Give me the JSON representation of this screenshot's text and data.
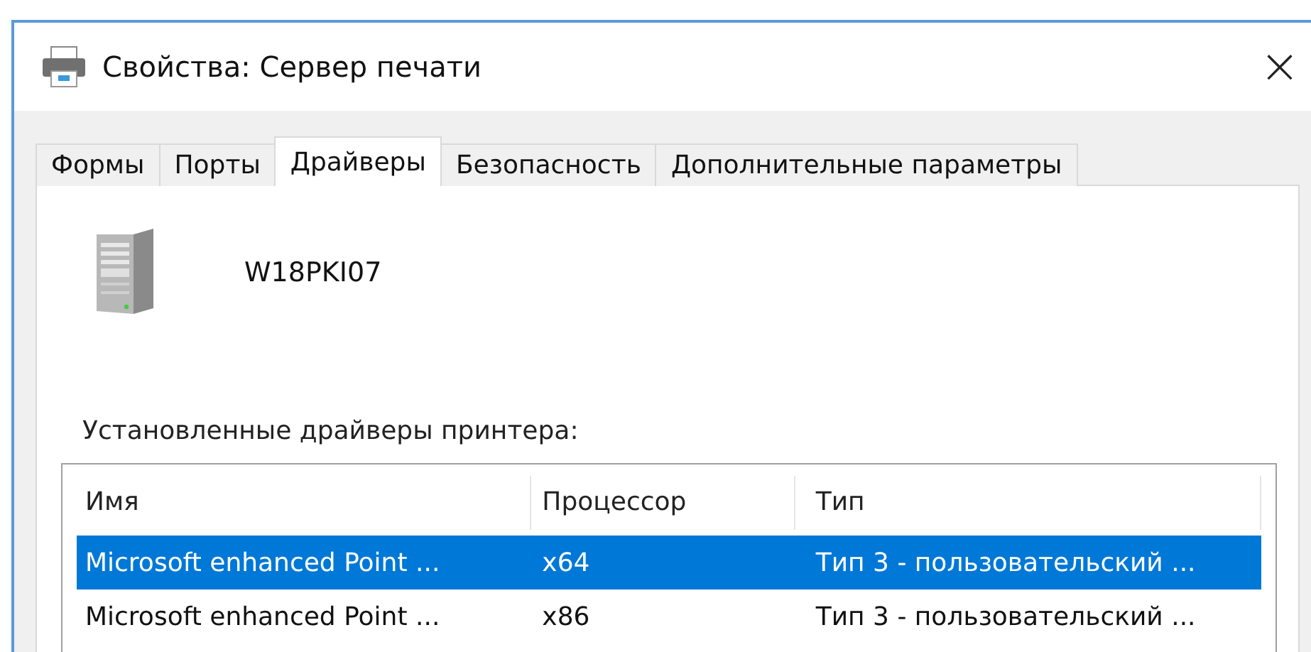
{
  "window": {
    "title": "Свойства: Сервер печати",
    "close": "×"
  },
  "tabs": [
    {
      "label": "Формы",
      "selected": false
    },
    {
      "label": "Порты",
      "selected": false
    },
    {
      "label": "Драйверы",
      "selected": true
    },
    {
      "label": "Безопасность",
      "selected": false
    },
    {
      "label": "Дополнительные параметры",
      "selected": false
    }
  ],
  "server_name": "W18PKI07",
  "drivers_label": "Установленные драйверы принтера:",
  "table": {
    "columns": [
      "Имя",
      "Процессор",
      "Тип"
    ],
    "rows": [
      {
        "cells": [
          "Microsoft enhanced Point ...",
          "x64",
          "Тип 3 - пользовательский ..."
        ],
        "selected": true
      },
      {
        "cells": [
          "Microsoft enhanced Point ...",
          "x86",
          "Тип 3 - пользовательский ..."
        ],
        "selected": false
      }
    ]
  }
}
